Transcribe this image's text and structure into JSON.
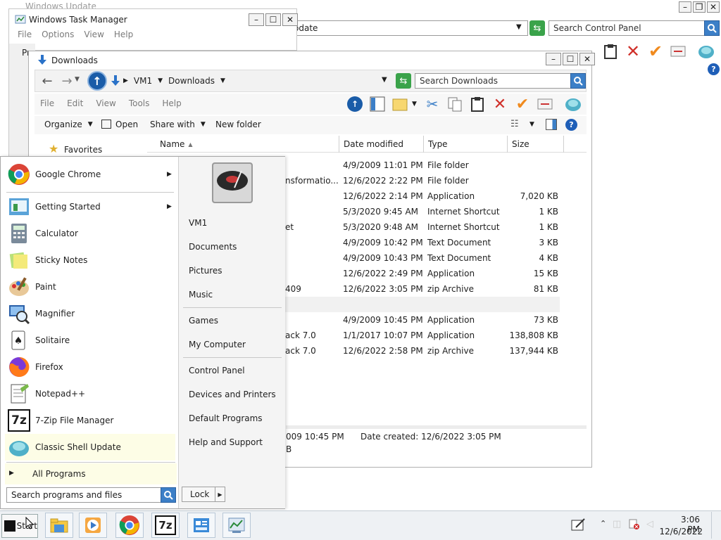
{
  "control_panel": {
    "title": "Windows Update",
    "address_text": "odate",
    "search_placeholder": "Search Control Panel"
  },
  "task_manager": {
    "title": "Windows Task Manager",
    "menu": [
      "File",
      "Options",
      "View",
      "Help"
    ],
    "tab_partial": "Pr"
  },
  "explorer": {
    "title": "Downloads",
    "breadcrumb": [
      "VM1",
      "Downloads"
    ],
    "search_placeholder": "Search Downloads",
    "menu": [
      "File",
      "Edit",
      "View",
      "Tools",
      "Help"
    ],
    "toolbar": {
      "organize": "Organize",
      "open": "Open",
      "share_with": "Share with",
      "new_folder": "New folder"
    },
    "nav_favorites": "Favorites",
    "columns": [
      "Name",
      "Date modified",
      "Type",
      "Size"
    ],
    "rows": [
      {
        "name": "",
        "date": "4/9/2009 11:01 PM",
        "type": "File folder",
        "size": ""
      },
      {
        "name": "nsformatio...",
        "date": "12/6/2022 2:22 PM",
        "type": "File folder",
        "size": ""
      },
      {
        "name": "",
        "date": "12/6/2022 2:14 PM",
        "type": "Application",
        "size": "7,020 KB"
      },
      {
        "name": "",
        "date": "5/3/2020 9:45 AM",
        "type": "Internet Shortcut",
        "size": "1 KB"
      },
      {
        "name": "et",
        "date": "5/3/2020 9:48 AM",
        "type": "Internet Shortcut",
        "size": "1 KB"
      },
      {
        "name": "",
        "date": "4/9/2009 10:42 PM",
        "type": "Text Document",
        "size": "3 KB"
      },
      {
        "name": "",
        "date": "4/9/2009 10:43 PM",
        "type": "Text Document",
        "size": "4 KB"
      },
      {
        "name": "",
        "date": "12/6/2022 2:49 PM",
        "type": "Application",
        "size": "15 KB"
      },
      {
        "name": "409",
        "date": "12/6/2022 3:05 PM",
        "type": "zip Archive",
        "size": "81 KB"
      },
      {
        "name": "",
        "date": "",
        "type": "",
        "size": ""
      },
      {
        "name": "",
        "date": "4/9/2009 10:45 PM",
        "type": "Application",
        "size": "73 KB"
      },
      {
        "name": "ack 7.0",
        "date": "1/1/2017 10:07 PM",
        "type": "Application",
        "size": "138,808 KB"
      },
      {
        "name": "ack 7.0",
        "date": "12/6/2022 2:58 PM",
        "type": "zip Archive",
        "size": "137,944 KB"
      }
    ],
    "details": {
      "modified_partial": "009 10:45 PM",
      "created": "Date created: 12/6/2022 3:05 PM",
      "size_partial": "B"
    }
  },
  "start_menu": {
    "programs": [
      {
        "label": "Google Chrome",
        "icon": "chrome-icon",
        "submenu": true
      },
      {
        "label": "Getting Started",
        "icon": "getting-started-icon",
        "submenu": true
      },
      {
        "label": "Calculator",
        "icon": "calculator-icon",
        "submenu": false
      },
      {
        "label": "Sticky Notes",
        "icon": "sticky-notes-icon",
        "submenu": false
      },
      {
        "label": "Paint",
        "icon": "paint-icon",
        "submenu": false
      },
      {
        "label": "Magnifier",
        "icon": "magnifier-icon",
        "submenu": false
      },
      {
        "label": "Solitaire",
        "icon": "solitaire-icon",
        "submenu": false
      },
      {
        "label": "Firefox",
        "icon": "firefox-icon",
        "submenu": false
      },
      {
        "label": "Notepad++",
        "icon": "notepadpp-icon",
        "submenu": false
      },
      {
        "label": "7-Zip File Manager",
        "icon": "7zip-icon",
        "submenu": false
      },
      {
        "label": "Classic Shell Update",
        "icon": "classic-shell-icon",
        "submenu": false
      }
    ],
    "all_programs": "All Programs",
    "search_placeholder": "Search programs and files",
    "right_items": [
      "VM1",
      "Documents",
      "Pictures",
      "Music",
      "Games",
      "My Computer",
      "Control Panel",
      "Devices and Printers",
      "Default Programs",
      "Help and Support"
    ],
    "lock_label": "Lock"
  },
  "taskbar": {
    "start_label": "Start",
    "time": "3:06 PM",
    "date": "12/6/2022"
  },
  "colors": {
    "accent_blue": "#3c7fc7",
    "highlight_yellow": "#fdfde6",
    "delete_red": "#d0302a",
    "check_orange": "#f08a1e"
  }
}
